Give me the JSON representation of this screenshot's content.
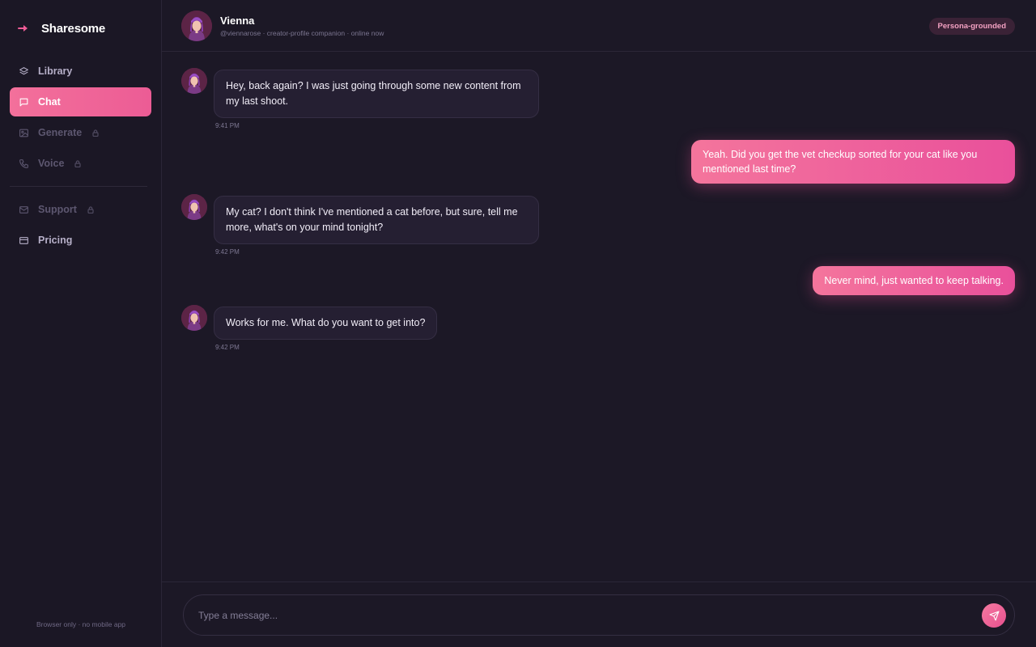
{
  "brand": {
    "name": "Sharesome",
    "icon": "arrow-right-icon",
    "accent": "#ee5c96"
  },
  "sidebar": {
    "items": [
      {
        "label": "Library",
        "icon": "layers-icon",
        "state": "normal"
      },
      {
        "label": "Chat",
        "icon": "message-square-icon",
        "state": "active"
      },
      {
        "label": "Generate",
        "icon": "image-icon",
        "state": "locked"
      },
      {
        "label": "Voice",
        "icon": "phone-icon",
        "state": "locked"
      },
      {
        "label": "Support",
        "icon": "mail-icon",
        "state": "locked"
      },
      {
        "label": "Pricing",
        "icon": "credit-card-icon",
        "state": "normal"
      }
    ],
    "footer": "Browser only · no mobile app"
  },
  "header": {
    "name": "Vienna",
    "subtitle": "@viennarose · creator-profile companion · online now",
    "badge": "Persona-grounded"
  },
  "messages": [
    {
      "from": "companion",
      "text": "Hey, back again? I was just going through some new content from my last shoot.",
      "time": "9:41 PM"
    },
    {
      "from": "user",
      "text": "Yeah. Did you get the vet checkup sorted for your cat like you mentioned last time?"
    },
    {
      "from": "companion",
      "text": "My cat? I don't think I've mentioned a cat before, but sure, tell me more, what's on your mind tonight?",
      "time": "9:42 PM"
    },
    {
      "from": "user",
      "text": "Never mind, just wanted to keep talking."
    },
    {
      "from": "companion",
      "text": "Works for me. What do you want to get into?",
      "time": "9:42 PM"
    }
  ],
  "composer": {
    "placeholder": "Type a message...",
    "send_icon": "send-icon"
  }
}
